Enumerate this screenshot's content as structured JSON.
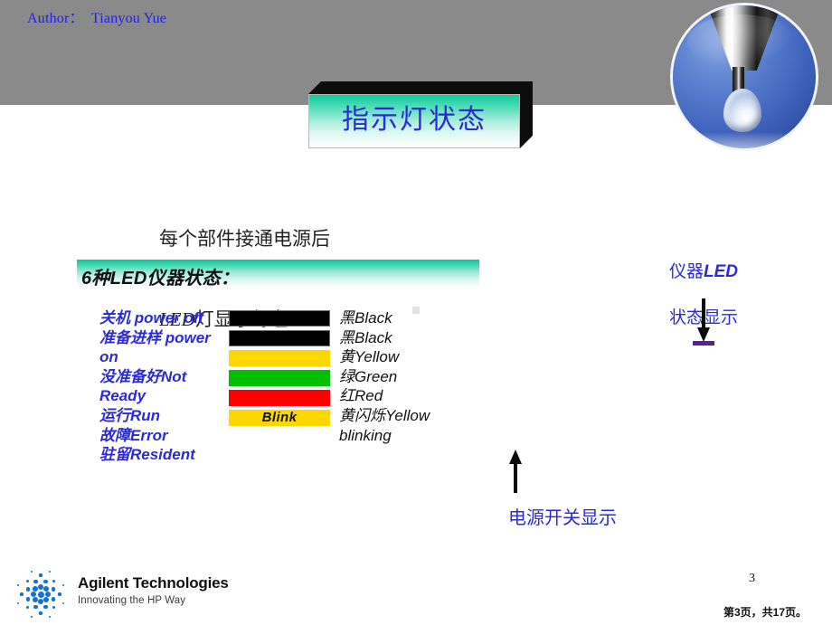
{
  "slide": {
    "author_line": "Author：  Tianyou Yue",
    "title": "指示灯状态",
    "intro_line1": "每个部件接通电源后",
    "intro_line2_italic": "LED",
    "intro_line2_rest": "灯显示绿色",
    "section_label": "6种LED仪器状态："
  },
  "led_table": {
    "left_labels": [
      "关机 power off",
      "准备进样 power on",
      "没准备好Not",
      "Ready",
      "运行Run",
      "故障Error",
      "驻留Resident"
    ],
    "rows": [
      {
        "state_cn": "关机",
        "state_en": "power off",
        "color_hex": "#000000",
        "color_cn": "黑",
        "color_en": "Black",
        "bar_text": ""
      },
      {
        "state_cn": "准备进样",
        "state_en": "power on",
        "color_hex": "#000000",
        "color_cn": "黑",
        "color_en": "Black",
        "bar_text": ""
      },
      {
        "state_cn": "没准备好",
        "state_en": "Not Ready",
        "color_hex": "#FFD700",
        "color_cn": "黄",
        "color_en": "Yellow",
        "bar_text": ""
      },
      {
        "state_cn": "运行",
        "state_en": "Run",
        "color_hex": "#00BF00",
        "color_cn": "绿",
        "color_en": "Green",
        "bar_text": ""
      },
      {
        "state_cn": "故障",
        "state_en": "Error",
        "color_hex": "#FF0000",
        "color_cn": "红",
        "color_en": "Red",
        "bar_text": ""
      },
      {
        "state_cn": "驻留",
        "state_en": "Resident",
        "color_hex": "#FFD700",
        "color_cn": "黄闪烁",
        "color_en": "Yellow blinking",
        "bar_text": "Blink"
      }
    ],
    "right_labels": [
      "黑Black",
      "黑Black",
      "黄Yellow",
      "绿Green",
      "红Red",
      "黄闪烁Yellow",
      "blinking"
    ],
    "blink_label": "Blink"
  },
  "annotations": {
    "right_line1_prefix": "仪器",
    "right_line1_italic": "LED",
    "right_line2": "状态显示",
    "right_text": "仪器LED\n状态显示",
    "bottom_text": "电源开关显示",
    "arrow_down_icon": "arrow-down-icon",
    "arrow_up_icon": "arrow-up-icon"
  },
  "footer": {
    "logo_name": "Agilent Technologies",
    "logo_tagline": "Innovating the HP Way",
    "page_number": "3",
    "page_of": "第3页，共17页。"
  },
  "colors": {
    "header_band": "#8a8a8a",
    "title_blue": "#2a2ad0",
    "accent_teal": "#09c79a",
    "annotation_blue": "#2a2ad8",
    "purple_dash": "#5c1b9e",
    "logo_blue": "#1570cf"
  }
}
